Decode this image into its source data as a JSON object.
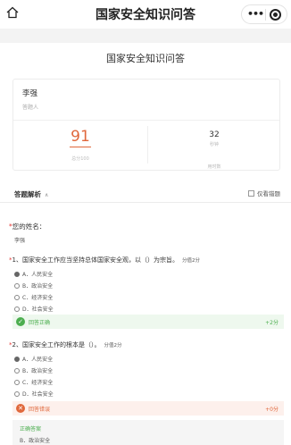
{
  "nav": {
    "title": "国家安全知识问答",
    "home_icon": "home-icon",
    "more_icon": "more-dots-icon",
    "close_icon": "target-circle-icon",
    "more_label": "•••"
  },
  "quiz": {
    "title": "国家安全知识问答"
  },
  "respondent": {
    "name": "李强",
    "role": "答题人"
  },
  "stats": {
    "score": "91",
    "score_caption": "总分100",
    "time_value": "32",
    "time_unit": "秒钟",
    "time_caption": "用时数"
  },
  "analysis": {
    "header": "答题解析",
    "collapse_glyph": "∧",
    "wrong_only_label": "仅看错题"
  },
  "name_question": {
    "label": "您的姓名：",
    "answer": "李强"
  },
  "questions": [
    {
      "text": "1、国家安全工作应当坚持总体国家安全观，以（）为宗旨。",
      "points": "分值2分",
      "options": [
        "A．人民安全",
        "B．政治安全",
        "C．经济安全",
        "D．社会安全"
      ],
      "selected": "A",
      "result": "回答正确",
      "gained": "+2分"
    },
    {
      "text": "2、国家安全工作的根本是（）。",
      "points": "分值2分",
      "options": [
        "A．人民安全",
        "B．政治安全",
        "C．经济安全",
        "D．社会安全"
      ],
      "selected": "A",
      "result": "回答错误",
      "gained": "+0分",
      "correct_label": "正确答案",
      "correct_answer": "B．政治安全"
    }
  ],
  "colors": {
    "accent": "#e0683c",
    "success": "#4cae4f",
    "required": "#e53935"
  }
}
